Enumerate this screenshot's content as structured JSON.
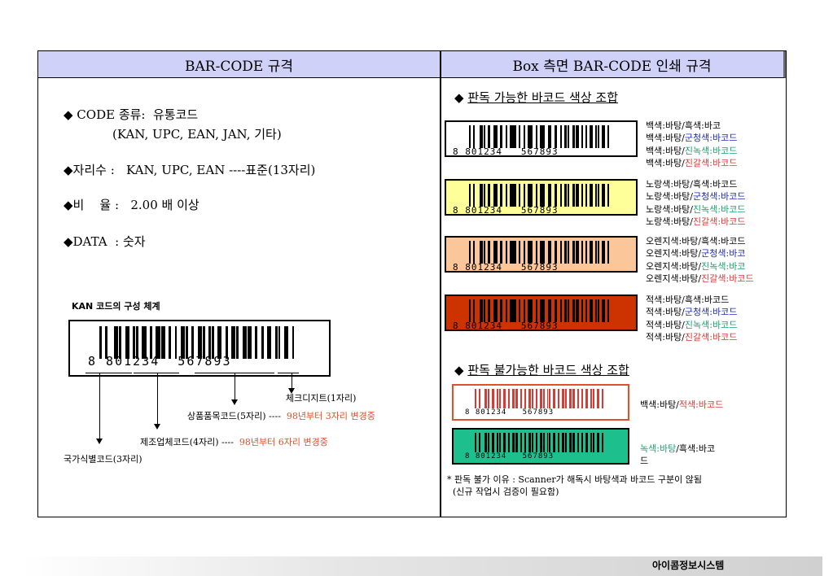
{
  "headers": {
    "left": "BAR-CODE 규격",
    "right": "Box 측면  BAR-CODE 인쇄 규격"
  },
  "spec": {
    "line1": "◆ CODE 종류:  유통코드",
    "line1b": "(KAN, UPC, EAN, JAN, 기타)",
    "line2": "◆자리수 :   KAN, UPC, EAN ----표준(13자리)",
    "line3": "◆비    율 :   2.00 배 이상",
    "line4": "◆DATA  : 숫자"
  },
  "kan": {
    "title": "KAN 코드의 구성 체계",
    "digits": "8 801234  567893",
    "check_digit": "체크디지트(1자리)",
    "product_code": "상품품목코드(5자리)",
    "product_note": "98년부터 3자리 변경중",
    "maker_code": "제조업체코드(4자리)",
    "maker_note": "98년부터 6자리 변경중",
    "country_code": "국가식별코드(3자리)",
    "dashes": "----"
  },
  "possible": {
    "title": "판독 가능한  바코드 색상 조합",
    "bullet": "◆",
    "barcode_digits": "8 801234   567893",
    "groups": [
      {
        "bg": "#ffffff",
        "bar": "#000000",
        "lines": [
          [
            {
              "t": "백색:바탕/흑색:바코",
              "c": ""
            }
          ],
          [
            {
              "t": "백색:바탕/",
              "c": ""
            },
            {
              "t": "군청색:바코드",
              "c": "blue"
            }
          ],
          [
            {
              "t": "백색:바탕/",
              "c": ""
            },
            {
              "t": "진녹색:바코드",
              "c": "green"
            }
          ],
          [
            {
              "t": "백색:바탕/",
              "c": ""
            },
            {
              "t": "진갈색:바코드",
              "c": "red2"
            }
          ]
        ]
      },
      {
        "bg": "#ffff99",
        "bar": "#000000",
        "lines": [
          [
            {
              "t": "노랑색:바탕/흑색:바코드",
              "c": ""
            }
          ],
          [
            {
              "t": "노랑색:바탕/",
              "c": ""
            },
            {
              "t": "군청색:바코드",
              "c": "blue"
            }
          ],
          [
            {
              "t": "노랑색:바탕/",
              "c": ""
            },
            {
              "t": "진녹색:바코드",
              "c": "green"
            }
          ],
          [
            {
              "t": "노랑색:바탕/",
              "c": ""
            },
            {
              "t": "진갈색:바코드",
              "c": "red2"
            }
          ]
        ]
      },
      {
        "bg": "#fbc79a",
        "bar": "#000000",
        "lines": [
          [
            {
              "t": "오렌지색:바탕/흑색:바코드",
              "c": ""
            }
          ],
          [
            {
              "t": "오렌지색:바탕/",
              "c": ""
            },
            {
              "t": "군청색:바코",
              "c": "blue"
            }
          ],
          [
            {
              "t": "오렌지색:바탕/",
              "c": ""
            },
            {
              "t": "진녹색:바코",
              "c": "green"
            }
          ],
          [
            {
              "t": "오렌지색:바탕/",
              "c": ""
            },
            {
              "t": "진갈색:바코드",
              "c": "red2"
            }
          ]
        ]
      },
      {
        "bg": "#cc3300",
        "bar": "#000000",
        "lines": [
          [
            {
              "t": "적색:바탕/흑색:바코드",
              "c": ""
            }
          ],
          [
            {
              "t": "적색:바탕/",
              "c": ""
            },
            {
              "t": "군청색:바코드",
              "c": "blue"
            }
          ],
          [
            {
              "t": "적색:바탕/",
              "c": ""
            },
            {
              "t": "진녹색:바코드",
              "c": "green"
            }
          ],
          [
            {
              "t": "적색:바탕/",
              "c": ""
            },
            {
              "t": "진갈색:바코드",
              "c": "red2"
            }
          ]
        ]
      }
    ]
  },
  "impossible": {
    "title": "판독 불가능한  바코드 색상 조합",
    "bullet": "◆",
    "barcode_digits": "8 801234   567893",
    "items": [
      {
        "bg": "#ffffff",
        "bar": "#d83a35",
        "border": "#e0502a",
        "lines": [
          [
            {
              "t": "백색:바탕/",
              "c": ""
            },
            {
              "t": "적색:바코드",
              "c": "red2"
            }
          ]
        ]
      },
      {
        "bg": "#1dbf8c",
        "bar": "#000000",
        "border": "#000000",
        "lines": [
          [
            {
              "t": "녹색:바탕",
              "c": "green"
            },
            {
              "t": "/흑색:바코",
              "c": ""
            }
          ],
          [
            {
              "t": "드",
              "c": ""
            }
          ]
        ]
      }
    ],
    "footnote1": "* 판독 불가 이유 : Scanner가 해독시 바탕색과 바코드 구분이 않됨",
    "footnote2": "  (신규 작업시 검증이 필요함)"
  },
  "footer": "아이콤정보시스템"
}
